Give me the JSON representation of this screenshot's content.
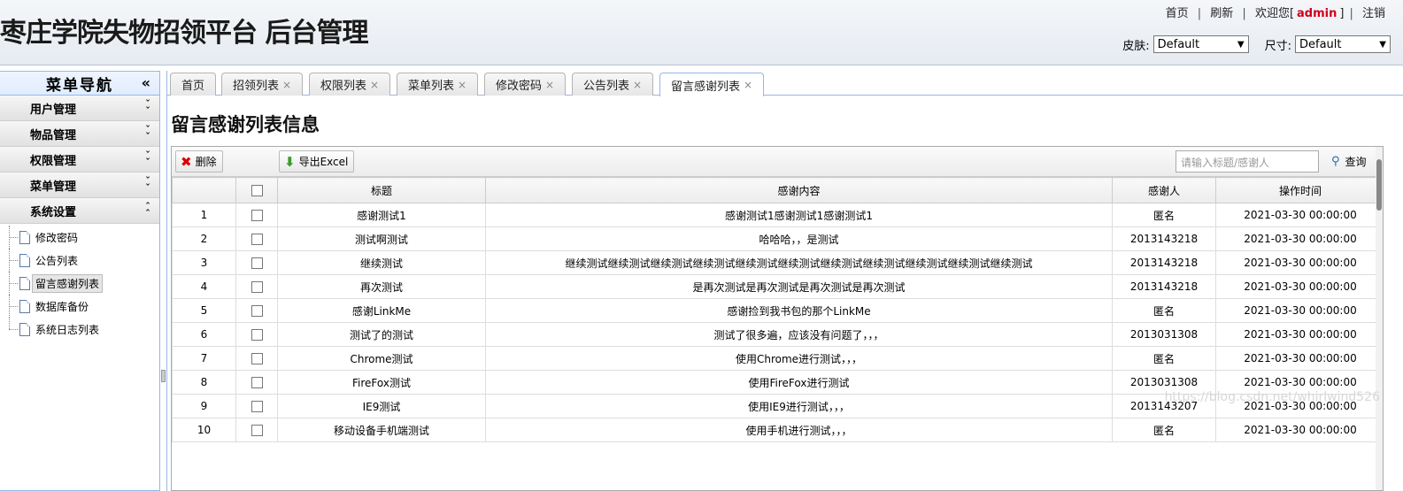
{
  "header": {
    "title": "枣庄学院失物招领平台 后台管理",
    "nav": {
      "home": "首页",
      "refresh": "刷新",
      "welcome_prefix": "欢迎您[",
      "user": "admin",
      "welcome_suffix": "]",
      "logout": "注销",
      "sep": "|"
    },
    "skin_label": "皮肤:",
    "skin_value": "Default",
    "size_label": "尺寸:",
    "size_value": "Default"
  },
  "sidebar": {
    "title": "菜单导航",
    "collapse_glyph": "«",
    "groups": [
      "用户管理",
      "物品管理",
      "权限管理",
      "菜单管理",
      "系统设置"
    ],
    "items": [
      "修改密码",
      "公告列表",
      "留言感谢列表",
      "数据库备份",
      "系统日志列表"
    ],
    "selected_item": "留言感谢列表"
  },
  "tabs": [
    "首页",
    "招领列表",
    "权限列表",
    "菜单列表",
    "修改密码",
    "公告列表",
    "留言感谢列表"
  ],
  "tab_close_glyph": "×",
  "active_tab": "留言感谢列表",
  "page_title": "留言感谢列表信息",
  "toolbar": {
    "delete_label": "删除",
    "export_label": "导出Excel",
    "search_placeholder": "请输入标题/感谢人",
    "query_label": "查询"
  },
  "table": {
    "columns": [
      "",
      "",
      "标题",
      "感谢内容",
      "感谢人",
      "操作时间"
    ],
    "rows": [
      [
        "1",
        "感谢测试1",
        "感谢测试1感谢测试1感谢测试1",
        "匿名",
        "2021-03-30 00:00:00"
      ],
      [
        "2",
        "测试啊测试",
        "哈哈哈，，是测试",
        "2013143218",
        "2021-03-30 00:00:00"
      ],
      [
        "3",
        "继续测试",
        "继续测试继续测试继续测试继续测试继续测试继续测试继续测试继续测试继续测试继续测试继续测试",
        "2013143218",
        "2021-03-30 00:00:00"
      ],
      [
        "4",
        "再次测试",
        "是再次测试是再次测试是再次测试是再次测试",
        "2013143218",
        "2021-03-30 00:00:00"
      ],
      [
        "5",
        "感谢LinkMe",
        "感谢捡到我书包的那个LinkMe",
        "匿名",
        "2021-03-30 00:00:00"
      ],
      [
        "6",
        "测试了的测试",
        "测试了很多遍，应该没有问题了，，，",
        "2013031308",
        "2021-03-30 00:00:00"
      ],
      [
        "7",
        "Chrome测试",
        "使用Chrome进行测试，，，",
        "匿名",
        "2021-03-30 00:00:00"
      ],
      [
        "8",
        "FireFox测试",
        "使用FireFox进行测试",
        "2013031308",
        "2021-03-30 00:00:00"
      ],
      [
        "9",
        "IE9测试",
        "使用IE9进行测试，，，",
        "2013143207",
        "2021-03-30 00:00:00"
      ],
      [
        "10",
        "移动设备手机端测试",
        "使用手机进行测试，，，",
        "匿名",
        "2021-03-30 00:00:00"
      ]
    ]
  },
  "watermark": "https://blog.csdn.net/whirlwind526"
}
